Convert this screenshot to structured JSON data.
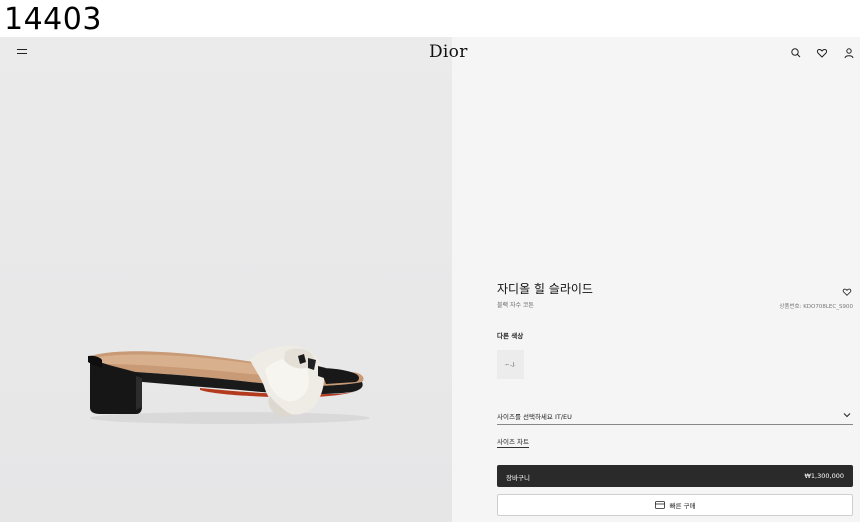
{
  "caption": "14403",
  "header": {
    "logo": "Dior",
    "icons": [
      "menu-icon",
      "search-icon",
      "heart-icon",
      "user-icon"
    ]
  },
  "product": {
    "title": "자디올 힐 슬라이드",
    "subtitle": "블랙 자수 코튼",
    "sku": "상품번호: KDO708LEC_S900",
    "other_colors_label": "다른 색상",
    "swatch_mark": "⌐..J.",
    "size_select_label": "사이즈를 선택하세요 IT/EU",
    "size_chart_link": "사이즈 차트",
    "cart_button_label": "장바구니",
    "price": "₩1,300,000",
    "quick_buy_label": "빠른 구매"
  },
  "colors": {
    "left_background": "#e9e9ea",
    "right_background": "#f5f5f5",
    "cart_button": "#2a2a2a"
  }
}
